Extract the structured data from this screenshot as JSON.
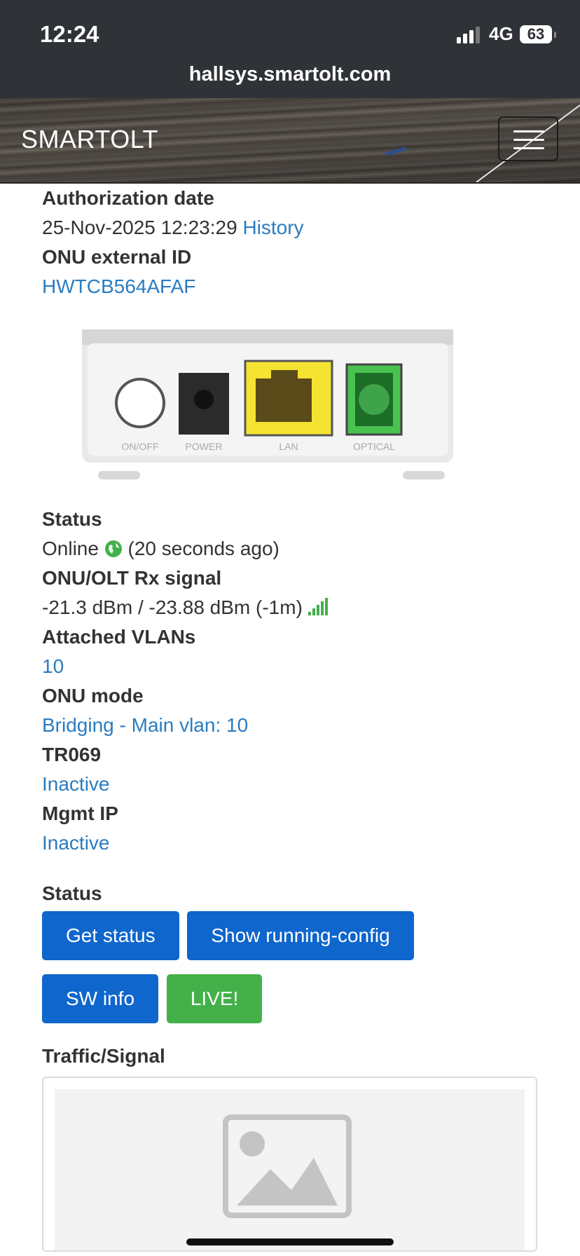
{
  "status_bar": {
    "time": "12:24",
    "network": "4G",
    "battery": "63"
  },
  "browser": {
    "url": "hallsys.smartolt.com"
  },
  "navbar": {
    "brand": "SMARTOLT"
  },
  "details": {
    "authorization_date_label": "Authorization date",
    "authorization_date_value": "25-Nov-2025 12:23:29",
    "history_link": "History",
    "onu_external_id_label": "ONU external ID",
    "onu_external_id_value": "HWTCB564AFAF",
    "device_ports": [
      "ON/OFF",
      "POWER",
      "LAN",
      "OPTICAL"
    ],
    "status_label": "Status",
    "status_value": "Online",
    "status_ago": "(20 seconds ago)",
    "rx_signal_label": "ONU/OLT Rx signal",
    "rx_signal_value": "-21.3 dBm / -23.88 dBm (-1m)",
    "vlans_label": "Attached VLANs",
    "vlans_value": "10",
    "onu_mode_label": "ONU mode",
    "onu_mode_value": "Bridging - Main vlan: 10",
    "tr069_label": "TR069",
    "tr069_value": "Inactive",
    "mgmt_ip_label": "Mgmt IP",
    "mgmt_ip_value": "Inactive"
  },
  "actions": {
    "section_label": "Status",
    "get_status": "Get status",
    "show_running_config": "Show running-config",
    "sw_info": "SW info",
    "live": "LIVE!"
  },
  "traffic": {
    "label": "Traffic/Signal"
  },
  "colors": {
    "link": "#2a7cc1",
    "primary_button": "#0f66cc",
    "live_button": "#43b049",
    "status_bar": "#2f3236"
  }
}
